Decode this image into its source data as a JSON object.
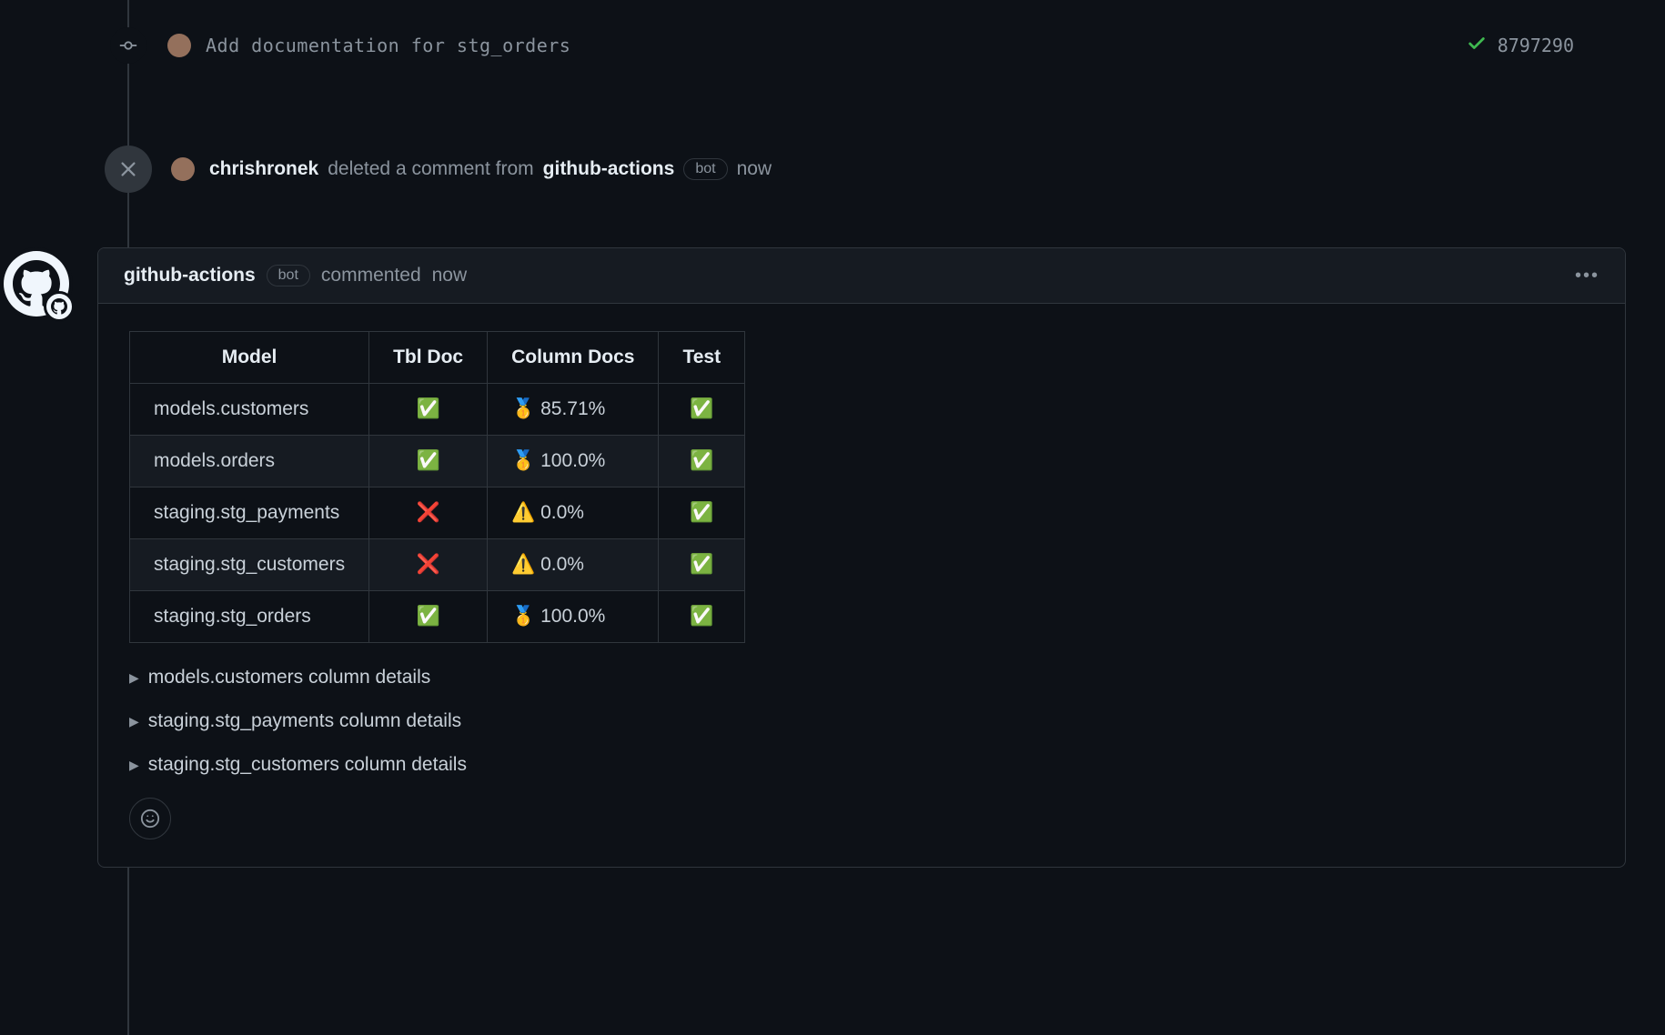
{
  "commit": {
    "message": "Add documentation for stg_orders",
    "short_sha": "8797290"
  },
  "deleted_event": {
    "actor": "chrishronek",
    "action_prefix": "deleted a comment from",
    "target": "github-actions",
    "bot_label": "bot",
    "time": "now"
  },
  "comment": {
    "author": "github-actions",
    "bot_label": "bot",
    "action": "commented",
    "time": "now",
    "table": {
      "headers": [
        "Model",
        "Tbl Doc",
        "Column Docs",
        "Test"
      ],
      "rows": [
        {
          "model": "models.customers",
          "tbl_doc": "✅",
          "col_docs": "🥇 85.71%",
          "test": "✅"
        },
        {
          "model": "models.orders",
          "tbl_doc": "✅",
          "col_docs": "🥇 100.0%",
          "test": "✅"
        },
        {
          "model": "staging.stg_payments",
          "tbl_doc": "❌",
          "col_docs": "⚠️ 0.0%",
          "test": "✅"
        },
        {
          "model": "staging.stg_customers",
          "tbl_doc": "❌",
          "col_docs": "⚠️ 0.0%",
          "test": "✅"
        },
        {
          "model": "staging.stg_orders",
          "tbl_doc": "✅",
          "col_docs": "🥇 100.0%",
          "test": "✅"
        }
      ]
    },
    "details": [
      "models.customers column details",
      "staging.stg_payments column details",
      "staging.stg_customers column details"
    ]
  }
}
